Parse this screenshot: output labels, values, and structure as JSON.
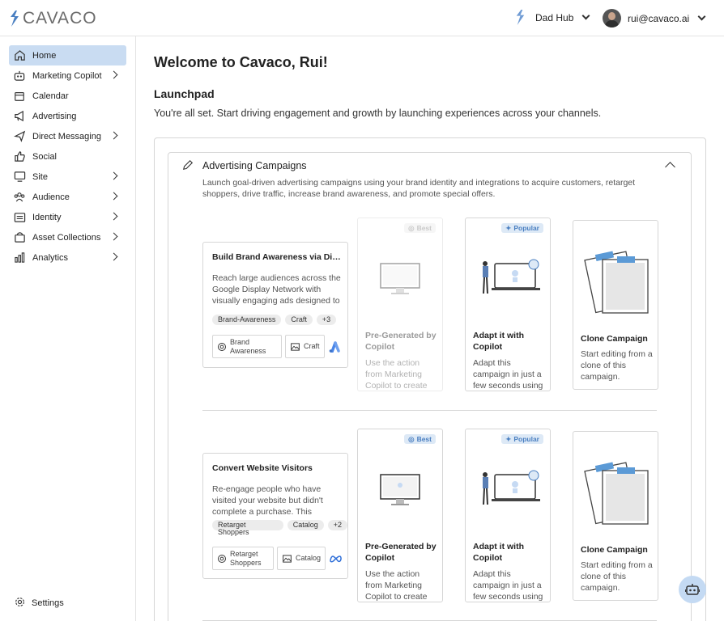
{
  "header": {
    "logo_text": "CAVACO",
    "workspace": "Dad Hub",
    "user_email": "rui@cavaco.ai"
  },
  "sidebar": {
    "items": [
      {
        "label": "Home",
        "icon": "home-icon",
        "active": true,
        "expandable": false
      },
      {
        "label": "Marketing Copilot",
        "icon": "robot-icon",
        "expandable": true
      },
      {
        "label": "Calendar",
        "icon": "calendar-icon",
        "expandable": false
      },
      {
        "label": "Advertising",
        "icon": "megaphone-icon",
        "expandable": false
      },
      {
        "label": "Direct Messaging",
        "icon": "send-icon",
        "expandable": true
      },
      {
        "label": "Social",
        "icon": "thumbs-up-icon",
        "expandable": false
      },
      {
        "label": "Site",
        "icon": "monitor-icon",
        "expandable": true
      },
      {
        "label": "Audience",
        "icon": "users-icon",
        "expandable": true
      },
      {
        "label": "Identity",
        "icon": "id-card-icon",
        "expandable": true
      },
      {
        "label": "Asset Collections",
        "icon": "bag-icon",
        "expandable": true
      },
      {
        "label": "Analytics",
        "icon": "bar-chart-icon",
        "expandable": true
      }
    ],
    "settings_label": "Settings"
  },
  "main": {
    "welcome": "Welcome to Cavaco, Rui!",
    "launchpad_title": "Launchpad",
    "launchpad_desc": "You're all set. Start driving engagement and growth by launching experiences across your channels.",
    "section": {
      "title": "Advertising Campaigns",
      "desc": "Launch goal-driven advertising campaigns using your brand identity and integrations to acquire customers, retarget shoppers, drive traffic, increase brand awareness, and promote special offers."
    },
    "campaigns": [
      {
        "title": "Build Brand Awareness via Display",
        "desc": "Reach large audiences across the Google Display Network with visually engaging ads designed to build brand awareness.",
        "tags": [
          "Brand-Awareness",
          "Craft",
          "+3"
        ],
        "chips": [
          {
            "label": "Brand Awareness"
          },
          {
            "label": "Craft"
          }
        ],
        "platform_icon": "google-ads-icon"
      },
      {
        "title": "Convert Website Visitors",
        "desc": "Re-engage people who have visited your website but didn't complete a purchase. This campaign retargets shoppers.",
        "tags": [
          "Retarget Shoppers",
          "Catalog",
          "+2"
        ],
        "chips": [
          {
            "label": "Retarget Shoppers"
          },
          {
            "label": "Catalog"
          }
        ],
        "platform_icon": "meta-icon"
      }
    ],
    "options": {
      "pregen": {
        "badge": "Best",
        "title": "Pre-Generated by Copilot",
        "desc": "Use the action from Marketing Copilot to create"
      },
      "adapt": {
        "badge": "Popular",
        "title": "Adapt it with Copilot",
        "desc": "Adapt this campaign in just a few seconds using"
      },
      "clone": {
        "title": "Clone Campaign",
        "desc": "Start editing from a clone of this campaign."
      }
    }
  },
  "colors": {
    "accent": "#4a7fc1",
    "active_nav": "#c9dcf2",
    "badge_bg": "#dde9f6",
    "border": "#d6d6d6"
  }
}
